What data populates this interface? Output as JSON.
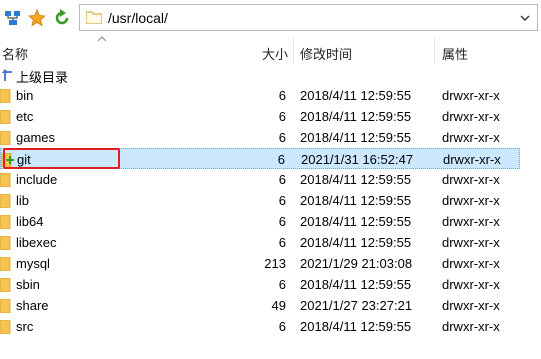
{
  "toolbar": {
    "path": "/usr/local/"
  },
  "columns": {
    "name": "名称",
    "size": "大小",
    "modified": "修改时间",
    "attributes": "属性"
  },
  "parent": {
    "label": "上级目录"
  },
  "rows": [
    {
      "name": "bin",
      "size": "6",
      "date": "2018/4/11 12:59:55",
      "perm": "drwxr-xr-x"
    },
    {
      "name": "etc",
      "size": "6",
      "date": "2018/4/11 12:59:55",
      "perm": "drwxr-xr-x"
    },
    {
      "name": "games",
      "size": "6",
      "date": "2018/4/11 12:59:55",
      "perm": "drwxr-xr-x"
    },
    {
      "name": "git",
      "size": "6",
      "date": "2021/1/31 16:52:47",
      "perm": "drwxr-xr-x"
    },
    {
      "name": "include",
      "size": "6",
      "date": "2018/4/11 12:59:55",
      "perm": "drwxr-xr-x"
    },
    {
      "name": "lib",
      "size": "6",
      "date": "2018/4/11 12:59:55",
      "perm": "drwxr-xr-x"
    },
    {
      "name": "lib64",
      "size": "6",
      "date": "2018/4/11 12:59:55",
      "perm": "drwxr-xr-x"
    },
    {
      "name": "libexec",
      "size": "6",
      "date": "2018/4/11 12:59:55",
      "perm": "drwxr-xr-x"
    },
    {
      "name": "mysql",
      "size": "213",
      "date": "2021/1/29 21:03:08",
      "perm": "drwxr-xr-x"
    },
    {
      "name": "sbin",
      "size": "6",
      "date": "2018/4/11 12:59:55",
      "perm": "drwxr-xr-x"
    },
    {
      "name": "share",
      "size": "49",
      "date": "2021/1/27 23:27:21",
      "perm": "drwxr-xr-x"
    },
    {
      "name": "src",
      "size": "6",
      "date": "2018/4/11 12:59:55",
      "perm": "drwxr-xr-x"
    }
  ],
  "icons": {
    "toolbar": [
      "network-drive-icon",
      "favorites-star-icon",
      "refresh-icon"
    ],
    "row": "folder-icon",
    "selected_badge": "new-plus-icon"
  },
  "colors": {
    "selection": "#cce8ff",
    "highlight": "#e02020",
    "folder": "#f6c453"
  }
}
